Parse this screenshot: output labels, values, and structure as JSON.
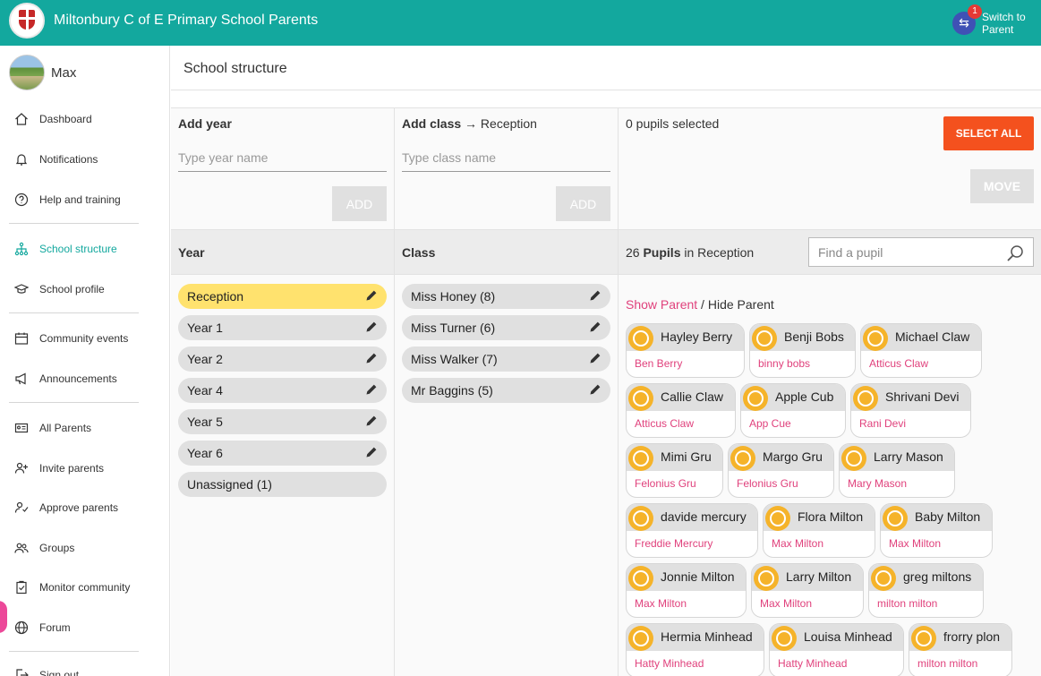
{
  "header": {
    "app_title": "Miltonbury C of E Primary School Parents",
    "switch_label": "Switch to Parent",
    "switch_badge": "1",
    "brand_color": "#13a89e"
  },
  "user": {
    "name": "Max"
  },
  "sidebar": {
    "items": [
      {
        "label": "Dashboard",
        "icon": "home-icon"
      },
      {
        "label": "Notifications",
        "icon": "bell-icon"
      },
      {
        "label": "Help and training",
        "icon": "help-icon"
      },
      {
        "label": "School structure",
        "icon": "structure-icon",
        "active": true
      },
      {
        "label": "School profile",
        "icon": "graduation-cap-icon"
      },
      {
        "label": "Community events",
        "icon": "calendar-icon"
      },
      {
        "label": "Announcements",
        "icon": "megaphone-icon"
      },
      {
        "label": "All Parents",
        "icon": "id-card-icon"
      },
      {
        "label": "Invite parents",
        "icon": "add-user-icon"
      },
      {
        "label": "Approve parents",
        "icon": "approve-user-icon"
      },
      {
        "label": "Groups",
        "icon": "group-icon"
      },
      {
        "label": "Monitor community",
        "icon": "monitor-icon"
      },
      {
        "label": "Forum",
        "icon": "globe-icon"
      },
      {
        "label": "Sign out",
        "icon": "sign-out-icon"
      }
    ]
  },
  "page": {
    "title": "School structure"
  },
  "add_year": {
    "title": "Add year",
    "placeholder": "Type year name",
    "button": "ADD"
  },
  "add_class": {
    "title": "Add class",
    "arrow": "→",
    "target": "Reception",
    "placeholder": "Type class name",
    "button": "ADD"
  },
  "selection": {
    "count_text": "0 pupils selected",
    "select_all": "SELECT ALL",
    "move": "MOVE"
  },
  "columns": {
    "year": "Year",
    "class": "Class"
  },
  "pupils_header": {
    "count": "26",
    "word": "Pupils",
    "suffix": "in Reception",
    "search_placeholder": "Find a pupil"
  },
  "years": [
    {
      "label": "Reception",
      "selected": true,
      "editable": true
    },
    {
      "label": "Year 1",
      "editable": true
    },
    {
      "label": "Year 2",
      "editable": true
    },
    {
      "label": "Year 4",
      "editable": true
    },
    {
      "label": "Year 5",
      "editable": true
    },
    {
      "label": "Year 6",
      "editable": true
    },
    {
      "label": "Unassigned (1)",
      "editable": false
    }
  ],
  "classes": [
    {
      "label": "Miss Honey (8)"
    },
    {
      "label": "Miss Turner (6)"
    },
    {
      "label": "Miss Walker (7)"
    },
    {
      "label": "Mr Baggins (5)"
    }
  ],
  "parent_toggle": {
    "show": "Show Parent",
    "separator": " / ",
    "hide": "Hide Parent"
  },
  "pupils": [
    {
      "name": "Hayley Berry",
      "parent": "Ben Berry"
    },
    {
      "name": "Benji Bobs",
      "parent": "binny bobs"
    },
    {
      "name": "Michael Claw",
      "parent": "Atticus Claw"
    },
    {
      "name": "Callie Claw",
      "parent": "Atticus Claw"
    },
    {
      "name": "Apple Cub",
      "parent": "App Cue"
    },
    {
      "name": "Shrivani Devi",
      "parent": "Rani Devi"
    },
    {
      "name": "Mimi Gru",
      "parent": "Felonius Gru"
    },
    {
      "name": "Margo Gru",
      "parent": "Felonius Gru"
    },
    {
      "name": "Larry Mason",
      "parent": "Mary Mason"
    },
    {
      "name": "davide mercury",
      "parent": "Freddie Mercury"
    },
    {
      "name": "Flora Milton",
      "parent": "Max Milton"
    },
    {
      "name": "Baby Milton",
      "parent": "Max Milton"
    },
    {
      "name": "Jonnie Milton",
      "parent": "Max Milton"
    },
    {
      "name": "Larry Milton",
      "parent": "Max Milton"
    },
    {
      "name": "greg miltons",
      "parent": "milton milton"
    },
    {
      "name": "Hermia Minhead",
      "parent": "Hatty Minhead"
    },
    {
      "name": "Louisa Minhead",
      "parent": "Hatty Minhead"
    },
    {
      "name": "frorry plon",
      "parent": "milton milton"
    }
  ]
}
